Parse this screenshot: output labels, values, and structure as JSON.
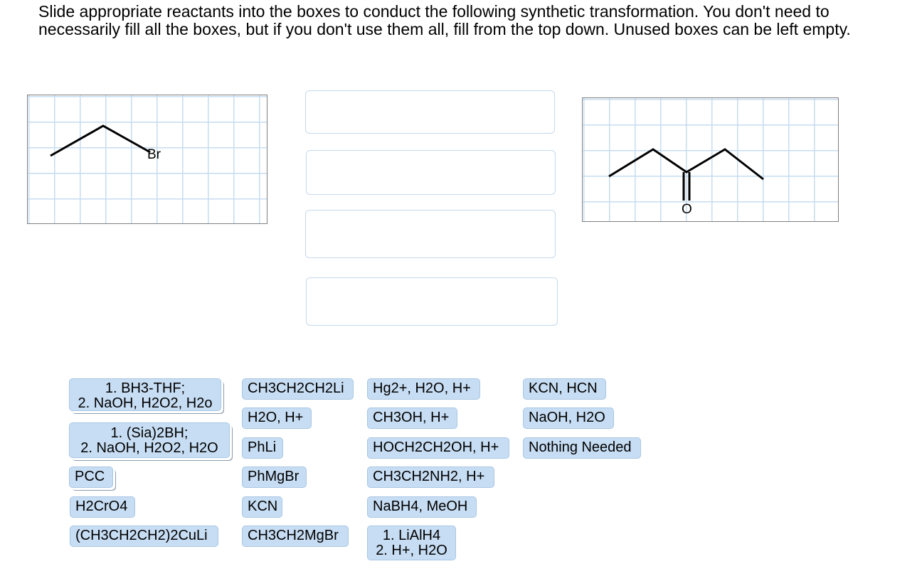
{
  "instructions": "Slide appropriate reactants into the boxes to conduct the following synthetic transformation.  You don't need to necessarily fill all the boxes, but if you don't use them all, fill from the top down.  Unused boxes can be left empty.",
  "starting_material": {
    "atom_label": "Br"
  },
  "product": {
    "atom_label": "O"
  },
  "drop_boxes": [
    "",
    "",
    "",
    ""
  ],
  "reagents": {
    "col1": [
      {
        "line1": "1.  BH3-THF;",
        "line2": "2. NaOH, H2O2, H2o"
      },
      {
        "line1": "1. (Sia)2BH;",
        "line2": "2.  NaOH, H2O2, H2O"
      },
      {
        "label": "PCC"
      },
      {
        "label": "H2CrO4"
      },
      {
        "label": "(CH3CH2CH2)2CuLi"
      }
    ],
    "col2": [
      {
        "label": "CH3CH2CH2Li"
      },
      {
        "label": "H2O, H+"
      },
      {
        "label": "PhLi"
      },
      {
        "label": "PhMgBr"
      },
      {
        "label": "KCN"
      },
      {
        "label": "CH3CH2MgBr"
      }
    ],
    "col3": [
      {
        "label": "Hg2+, H2O, H+"
      },
      {
        "label": "CH3OH, H+"
      },
      {
        "label": "HOCH2CH2OH, H+"
      },
      {
        "label": "CH3CH2NH2, H+"
      },
      {
        "label": "NaBH4, MeOH"
      },
      {
        "line1": "1.  LiAlH4",
        "line2": "2.  H+, H2O"
      }
    ],
    "col4": [
      {
        "label": "KCN, HCN"
      },
      {
        "label": "NaOH, H2O"
      },
      {
        "label": "Nothing Needed"
      }
    ]
  },
  "colors": {
    "chip_fill": "#c7ddf3",
    "chip_border": "#a9c7e4",
    "grid_line": "#c6dcf0",
    "drop_border": "#c5d9ec"
  }
}
